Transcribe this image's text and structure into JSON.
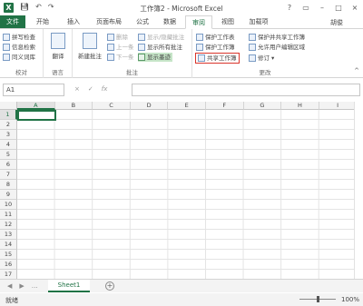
{
  "window": {
    "title": "工作簿2 - Microsoft Excel",
    "app_icon": "X",
    "qat_icons": [
      "save-icon",
      "undo-icon",
      "redo-icon"
    ],
    "controls": [
      "?",
      "▭",
      "–",
      "□",
      "×"
    ]
  },
  "tabs": [
    {
      "label": "文件"
    },
    {
      "label": "开始"
    },
    {
      "label": "插入"
    },
    {
      "label": "页面布局"
    },
    {
      "label": "公式"
    },
    {
      "label": "数据"
    },
    {
      "label": "审阅"
    },
    {
      "label": "视图"
    },
    {
      "label": "加载项"
    }
  ],
  "active_tab": "审阅",
  "user": "胡俊",
  "ribbon": {
    "proofing": {
      "label": "校对",
      "items": [
        "拼写检查",
        "信息检索",
        "同义词库"
      ]
    },
    "language": {
      "label": "语言",
      "translate": "翻译"
    },
    "comments": {
      "label": "批注",
      "new_comment": "新建批注",
      "delete": "删除",
      "previous": "上一条",
      "next": "下一条",
      "show_hide": "显示/隐藏批注",
      "show_all": "显示所有批注",
      "show_ink": "显示墨迹"
    },
    "changes": {
      "label": "更改",
      "protect_sheet": "保护工作表",
      "protect_workbook": "保护工作簿",
      "share_workbook": "共享工作簿",
      "protect_share": "保护并共享工作簿",
      "allow_edit": "允许用户编辑区域",
      "track_changes": "修订"
    }
  },
  "formula_bar": {
    "name_box": "A1",
    "icons": [
      "×",
      "✓",
      "fx"
    ],
    "content": ""
  },
  "grid": {
    "columns": [
      "A",
      "B",
      "C",
      "D",
      "E",
      "F",
      "G",
      "H",
      "I"
    ],
    "rows": [
      "1",
      "2",
      "3",
      "4",
      "5",
      "6",
      "7",
      "8",
      "9",
      "10",
      "11",
      "12",
      "13",
      "14",
      "15",
      "16",
      "17"
    ],
    "active_cell": "A1"
  },
  "sheets": {
    "tabs": [
      "Sheet1"
    ],
    "nav": [
      "◀",
      "▶",
      "…"
    ],
    "add": "+"
  },
  "status": {
    "text": "就绪",
    "zoom": "100%"
  }
}
